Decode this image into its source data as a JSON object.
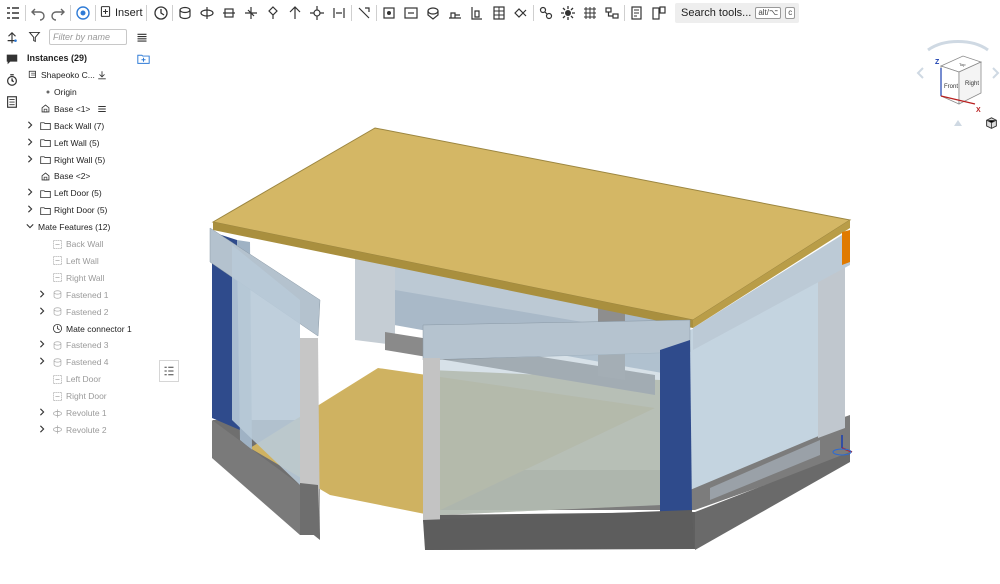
{
  "toolbar": {
    "insert_label": "Insert",
    "search_label": "Search tools...",
    "search_shortcut_1": "alt/⌥",
    "search_shortcut_2": "c",
    "icons": [
      "feature-list-icon",
      "undo-icon",
      "redo-icon",
      "simulation-icon",
      "insert-icon",
      "mate-connector-icon",
      "fastened-mate-icon",
      "revolute-mate-icon",
      "slider-mate-icon",
      "planar-mate-icon",
      "cylindrical-mate-icon",
      "pin-slot-mate-icon",
      "ball-mate-icon",
      "parallel-mate-icon",
      "tangent-mate-icon",
      "width-mate-icon",
      "group-icon",
      "replicate-icon",
      "mate-relation-icon",
      "gear-relation-icon",
      "rack-pinion-icon",
      "screw-relation-icon",
      "linear-relation-icon",
      "measure-icon",
      "section-view-icon",
      "named-views-icon",
      "explode-icon",
      "bom-icon"
    ]
  },
  "panel": {
    "filter_placeholder": "Filter by name",
    "instances_title": "Instances (29)",
    "rows": [
      {
        "label": "Shapeoko C...",
        "icon": "assembly-icon",
        "chevron": false,
        "indent": 0,
        "dim": false,
        "extra": "download-icon"
      },
      {
        "label": "Origin",
        "icon": "origin-icon",
        "chevron": false,
        "indent": 1,
        "dim": false
      },
      {
        "label": "Base <1>",
        "icon": "part-instance-icon",
        "chevron": false,
        "indent": 1,
        "dim": false,
        "extra": "list-icon"
      },
      {
        "label": "Back Wall (7)",
        "icon": "folder-icon",
        "chevron": true,
        "indent": 0,
        "dim": false
      },
      {
        "label": "Left Wall (5)",
        "icon": "folder-icon",
        "chevron": true,
        "indent": 0,
        "dim": false
      },
      {
        "label": "Right Wall (5)",
        "icon": "folder-icon",
        "chevron": true,
        "indent": 0,
        "dim": false
      },
      {
        "label": "Base <2>",
        "icon": "part-instance-icon",
        "chevron": false,
        "indent": 1,
        "dim": false
      },
      {
        "label": "Left Door (5)",
        "icon": "folder-icon",
        "chevron": true,
        "indent": 0,
        "dim": false
      },
      {
        "label": "Right Door (5)",
        "icon": "folder-icon",
        "chevron": true,
        "indent": 0,
        "dim": false
      },
      {
        "label": "Mate Features (12)",
        "icon": "",
        "chevron": "open",
        "indent": -1,
        "dim": false
      },
      {
        "label": "Back Wall",
        "icon": "group-icon",
        "chevron": false,
        "indent": 2,
        "dim": true
      },
      {
        "label": "Left Wall",
        "icon": "group-icon",
        "chevron": false,
        "indent": 2,
        "dim": true
      },
      {
        "label": "Right Wall",
        "icon": "group-icon",
        "chevron": false,
        "indent": 2,
        "dim": true
      },
      {
        "label": "Fastened 1",
        "icon": "fastened-icon",
        "chevron": true,
        "indent": 2,
        "dim": true
      },
      {
        "label": "Fastened 2",
        "icon": "fastened-icon",
        "chevron": true,
        "indent": 2,
        "dim": true
      },
      {
        "label": "Mate connector 1",
        "icon": "mate-connector-icon",
        "chevron": false,
        "indent": 2,
        "dim": false
      },
      {
        "label": "Fastened 3",
        "icon": "fastened-icon",
        "chevron": true,
        "indent": 2,
        "dim": true
      },
      {
        "label": "Fastened 4",
        "icon": "fastened-icon",
        "chevron": true,
        "indent": 2,
        "dim": true
      },
      {
        "label": "Left Door",
        "icon": "group-icon",
        "chevron": false,
        "indent": 2,
        "dim": true
      },
      {
        "label": "Right Door",
        "icon": "group-icon",
        "chevron": false,
        "indent": 2,
        "dim": true
      },
      {
        "label": "Revolute 1",
        "icon": "revolute-icon",
        "chevron": true,
        "indent": 2,
        "dim": true
      },
      {
        "label": "Revolute 2",
        "icon": "revolute-icon",
        "chevron": true,
        "indent": 2,
        "dim": true
      }
    ]
  },
  "viewcube": {
    "front": "Front",
    "right": "Right",
    "top": "Top",
    "axis_z": "Z",
    "axis_x": "X"
  },
  "colors": {
    "wood": "#d4b765",
    "panel_blue": "#2f4b8c",
    "frame_grey": "#b8bfc6",
    "glass": "#c9d9e6",
    "base_dark": "#7a7a7a",
    "accent": "#e07a00"
  }
}
